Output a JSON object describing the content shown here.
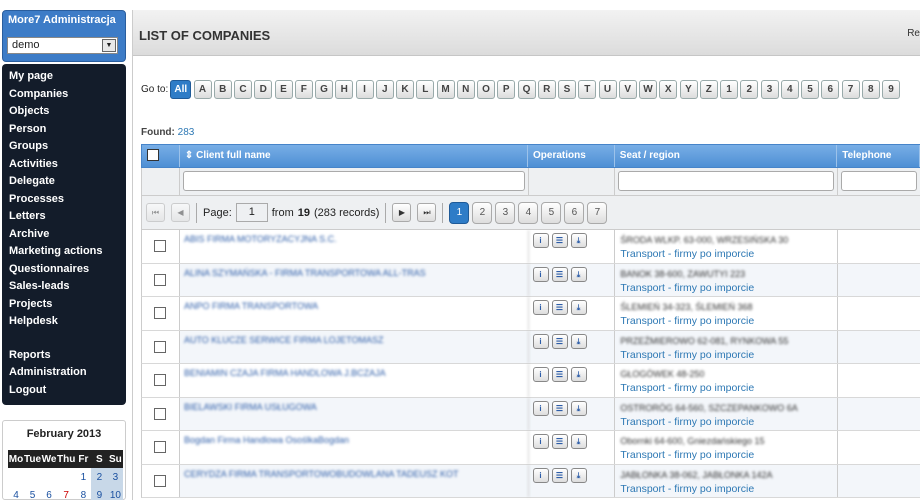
{
  "sidebar": {
    "title": "More7 Administracja",
    "select_value": "demo",
    "menu": [
      "My page",
      "Companies",
      "Objects",
      "Person",
      "Groups",
      "Activities",
      "Delegate",
      "Processes",
      "Letters",
      "Archive",
      "Marketing actions",
      "Questionnaires",
      "Sales-leads",
      "Projects",
      "Helpdesk"
    ],
    "menu2": [
      "Reports",
      "Administration",
      "Logout"
    ]
  },
  "calendar": {
    "month": "February 2013",
    "days": [
      "Mo",
      "Tue",
      "We",
      "Thu",
      "Fr",
      "S",
      "Su"
    ],
    "row1": [
      "",
      "",
      "",
      "",
      "1",
      "2",
      "3"
    ],
    "row2": [
      "4",
      "5",
      "6",
      "7",
      "8",
      "9",
      "10"
    ]
  },
  "page": {
    "title": "LIST OF COMPANIES",
    "right": "Re"
  },
  "goto": {
    "label": "Go to:",
    "letters": [
      "All",
      "A",
      "B",
      "C",
      "D",
      "E",
      "F",
      "G",
      "H",
      "I",
      "J",
      "K",
      "L",
      "M",
      "N",
      "O",
      "P",
      "Q",
      "R",
      "S",
      "T",
      "U",
      "V",
      "W",
      "X",
      "Y",
      "Z",
      "1",
      "2",
      "3",
      "4",
      "5",
      "6",
      "7",
      "8",
      "9"
    ]
  },
  "found": {
    "label": "Found:",
    "count": "283"
  },
  "columns": {
    "name": "Client full name",
    "ops": "Operations",
    "seat": "Seat / region",
    "tel": "Telephone"
  },
  "pager": {
    "page_label": "Page:",
    "page_value": "1",
    "from": "from",
    "total": "19",
    "records": "(283 records)",
    "pages": [
      "1",
      "2",
      "3",
      "4",
      "5",
      "6",
      "7"
    ]
  },
  "rows": [
    {
      "name": "ABIS FIRMA MOTORYZACYJNA S.C.",
      "addr": "ŚRODA WLKP. 63-000, WRZESIŃSKA 30",
      "cat": "Transport - firmy po imporcie"
    },
    {
      "name": "ALINA SZYMAŃSKA - FIRMA TRANSPORTOWA ALL-TRAS",
      "addr": "BANOK 38-600, ZAWUTYI 223",
      "cat": "Transport - firmy po imporcie"
    },
    {
      "name": "ANPO FIRMA TRANSPORTOWA",
      "addr": "ŚLEMIEŃ 34-323, ŚLEMIEŃ 368",
      "cat": "Transport - firmy po imporcie"
    },
    {
      "name": "AUTO KLUCZE SERWICE FIRMA LOJETOMASZ",
      "addr": "PRZEŹMIEROWO 62-081, RYNKOWA 55",
      "cat": "Transport - firmy po imporcie"
    },
    {
      "name": "BENIAMIN CZAJA FIRMA HANDLOWA J.BCZAJA",
      "addr": "GŁOGÓWEK 48-250",
      "cat": "Transport - firmy po imporcie"
    },
    {
      "name": "BIELAWSKI FIRMA USŁUGOWA",
      "addr": "OSTRORÓG 64-560, SZCZEPANKOWO 6A",
      "cat": "Transport - firmy po imporcie"
    },
    {
      "name": "Bogdan Firma Handlowa OsoślkaBogdan",
      "addr": "Obornki 64-600, Gniezdańskiego 15",
      "cat": "Transport - firmy po imporcie"
    },
    {
      "name": "CERYDZA FIRMA TRANSPORTOWOBUDOWLANA TADEUSZ KOT",
      "addr": "JABŁONKA 38-062, JABŁONKA 142A",
      "cat": "Transport - firmy po imporcie"
    }
  ]
}
